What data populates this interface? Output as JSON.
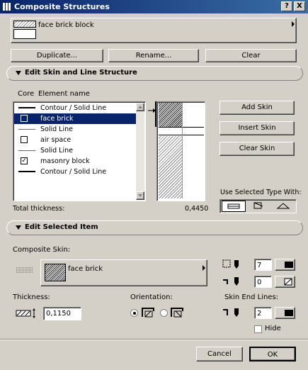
{
  "window": {
    "title": "Composite Structures",
    "help_label": "?",
    "close_label": "X"
  },
  "composite": {
    "selected_name": "face brick block"
  },
  "buttons": {
    "duplicate": "Duplicate...",
    "rename": "Rename...",
    "clear": "Clear"
  },
  "skin_section": {
    "header": "Edit Skin and Line Structure",
    "col_core": "Core",
    "col_name": "Element name",
    "rows": [
      {
        "kind": "line",
        "text": "Contour / Solid Line",
        "selected": false
      },
      {
        "kind": "skin",
        "text": "face brick",
        "selected": true,
        "core": false
      },
      {
        "kind": "line-thin",
        "text": "Solid Line",
        "selected": false
      },
      {
        "kind": "skin",
        "text": "air space",
        "selected": false,
        "core": false
      },
      {
        "kind": "line-thin",
        "text": "Solid Line",
        "selected": false
      },
      {
        "kind": "skin",
        "text": "masonry block",
        "selected": false,
        "core": true
      },
      {
        "kind": "line",
        "text": "Contour / Solid Line",
        "selected": false
      }
    ],
    "add_skin": "Add Skin",
    "insert_skin": "Insert Skin",
    "clear_skin": "Clear Skin",
    "use_selected_type_with": "Use Selected Type With:",
    "total_thickness_label": "Total thickness:",
    "total_thickness_value": "0,4450"
  },
  "item_section": {
    "header": "Edit Selected Item",
    "composite_skin_label": "Composite Skin:",
    "skin_fill_name": "face brick",
    "pen_top_value": "7",
    "pen_bottom_value": "0",
    "thickness_label": "Thickness:",
    "thickness_value": "0,1150",
    "orientation_label": "Orientation:",
    "skin_end_lines_label": "Skin End Lines:",
    "end_line_pen_value": "2",
    "hide_label": "Hide"
  },
  "footer": {
    "cancel": "Cancel",
    "ok": "OK"
  },
  "icons": {
    "disclosure": "triangle-down",
    "menu_arrow": "triangle-right",
    "line_type_end": "empty-symbol",
    "checkbox_checked_mark": "✓"
  }
}
